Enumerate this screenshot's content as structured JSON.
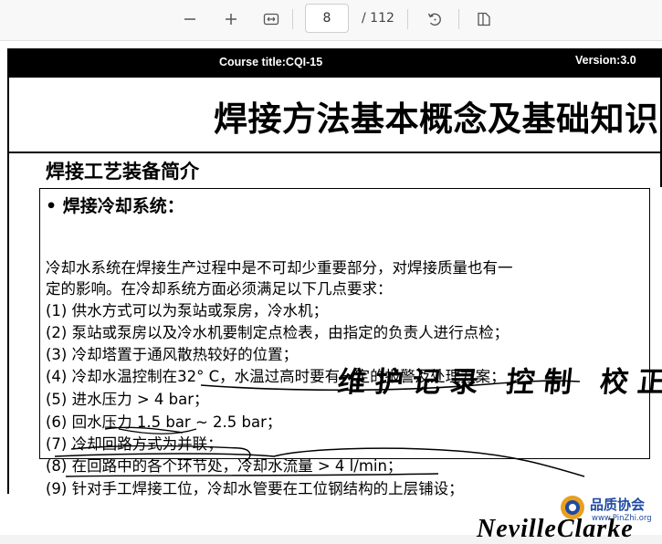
{
  "toolbar": {
    "page_number": "8",
    "page_total": "/ 112",
    "buttons": [
      {
        "name": "zoom-out-button",
        "icon": "minus-icon"
      },
      {
        "name": "zoom-in-button",
        "icon": "plus-icon"
      },
      {
        "name": "fit-width-button",
        "icon": "fit-width-icon"
      },
      {
        "name": "rotate-button",
        "icon": "rotate-icon"
      },
      {
        "name": "page-view-button",
        "icon": "page-view-icon"
      }
    ]
  },
  "slide": {
    "course_title": "Course title:CQI-15",
    "version": "Version:3.0",
    "main_title": "焊接方法基本概念及基础知识",
    "section_title": "焊接工艺装备简介",
    "bullet_title": "• 焊接冷却系统：",
    "intro_line1": "冷却水系统在焊接生产过程中是不可却少重要部分，对焊接质量也有一",
    "intro_line2": "定的影响。在冷却系统方面必须满足以下几点要求：",
    "items": [
      "(1) 供水方式可以为泵站或泵房，冷水机；",
      "(2) 泵站或泵房以及冷水机要制定点检表，由指定的负责人进行点检；",
      "(3) 冷却塔置于通风散热较好的位置；",
      "(4) 冷却水温控制在32° C，水温过高时要有一定的报警及处理方案；",
      "(5) 进水压力 > 4 bar；",
      "(6) 回水压力 1.5 bar ~ 2.5 bar；",
      "(7) 冷却回路方式为并联；",
      "(8) 在回路中的各个环节处，冷却水流量 > 4 l/min；",
      "(9) 针对手工焊接工位，冷却水管要在工位钢结构的上层铺设；"
    ],
    "handwritten_note": "维护记录 控制 校正",
    "footer_logo": "NevilleClarke"
  },
  "watermark": {
    "name": "品质协会",
    "url": "www.PinZhi.org"
  },
  "colors": {
    "toolbar_bg": "#f8f8f8",
    "header_bar": "#000000",
    "watermark_blue": "#1f4aa3"
  }
}
